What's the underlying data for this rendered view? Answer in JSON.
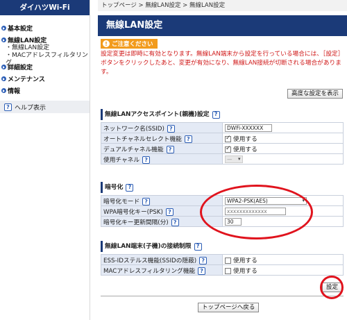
{
  "sidebar": {
    "brand": "ダイハツWi-Fi",
    "groups": [
      {
        "label": "基本設定"
      },
      {
        "label": "無線LAN設定",
        "children": [
          "・無線LAN設定",
          "・MACアドレスフィルタリング"
        ]
      },
      {
        "label": "詳細設定"
      },
      {
        "label": "メンテナンス"
      },
      {
        "label": "情報"
      }
    ],
    "help_label": "ヘルプ表示"
  },
  "breadcrumb": "トップページ > 無線LAN設定 > 無線LAN設定",
  "page_title": "無線LAN設定",
  "notice": {
    "badge": "ご注意ください",
    "text": "設定変更は即時に有効となります。無線LAN端末から設定を行っている場合には、［設定］ボタンをクリックしたあと、変更が有効になり、無線LAN接続が切断される場合があります。"
  },
  "advanced_button": "高度な設定を表示",
  "sections": {
    "ap": {
      "title": "無線LANアクセスポイント(親機)設定",
      "rows": {
        "ssid_label": "ネットワーク名(SSID)",
        "ssid_value": "DWFi-XXXXXX",
        "auto_channel_label": "オートチャネルセレクト機能",
        "auto_channel_value": "使用する",
        "dual_channel_label": "デュアルチャネル機能",
        "dual_channel_value": "使用する",
        "channel_label": "使用チャネル",
        "channel_value": "—"
      }
    },
    "encryption": {
      "title": "暗号化",
      "rows": {
        "mode_label": "暗号化モード",
        "mode_value": "WPA2-PSK(AES)",
        "key_label": "WPA暗号化キー(PSK)",
        "key_value": "xxxxxxxxxxxxx",
        "interval_label": "暗号化キー更新間隔(分)",
        "interval_value": "30"
      }
    },
    "restriction": {
      "title": "無線LAN端末(子機)の接続制限",
      "rows": {
        "stealth_label": "ESS-IDステルス機能(SSIDの隠蔽)",
        "stealth_value": "使用する",
        "mac_label": "MACアドレスフィルタリング機能",
        "mac_value": "使用する"
      }
    }
  },
  "buttons": {
    "apply": "設定",
    "back_top": "トップページへ戻る"
  },
  "help_icon_glyph": "?",
  "colors": {
    "header_blue": "#1b3a78",
    "notice_orange": "#f29b1d",
    "warning_red": "#d01818",
    "annotation_red": "#e0131d"
  }
}
